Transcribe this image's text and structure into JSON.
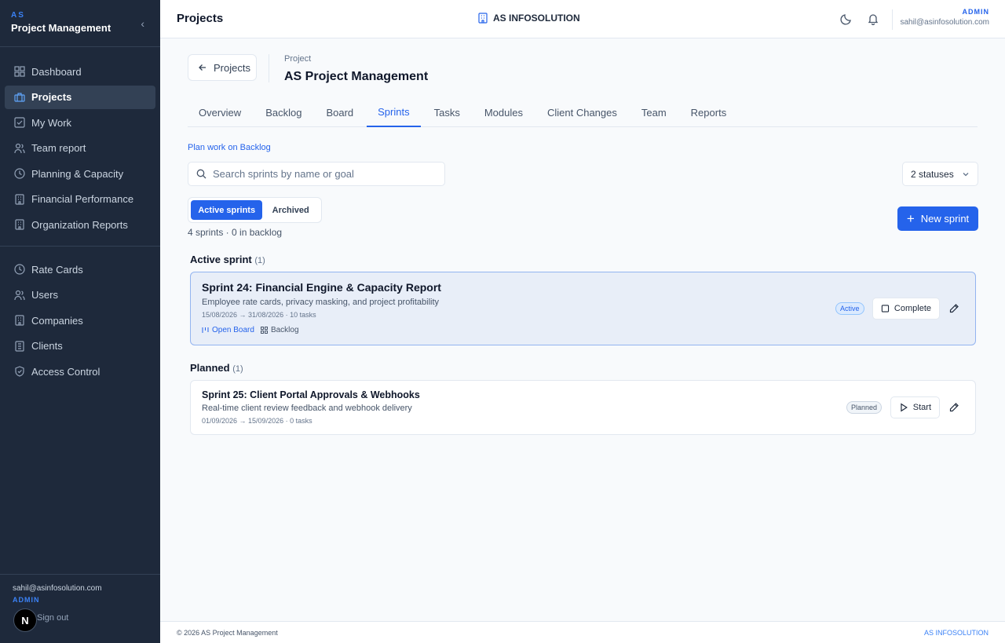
{
  "sidebar": {
    "brand_short": "AS",
    "brand_name": "Project Management",
    "nav_primary": [
      {
        "label": "Dashboard",
        "icon": "dashboard-icon"
      },
      {
        "label": "Projects",
        "icon": "briefcase-icon",
        "active": true
      },
      {
        "label": "My Work",
        "icon": "check-square-icon"
      },
      {
        "label": "Team report",
        "icon": "users-icon"
      },
      {
        "label": "Planning & Capacity",
        "icon": "clock-icon"
      },
      {
        "label": "Financial Performance",
        "icon": "building-icon"
      },
      {
        "label": "Organization Reports",
        "icon": "building-icon"
      }
    ],
    "nav_secondary": [
      {
        "label": "Rate Cards",
        "icon": "clock-icon"
      },
      {
        "label": "Users",
        "icon": "users-icon"
      },
      {
        "label": "Companies",
        "icon": "building-icon"
      },
      {
        "label": "Clients",
        "icon": "building-icon"
      },
      {
        "label": "Access Control",
        "icon": "shield-icon"
      }
    ],
    "footer": {
      "email": "sahil@asinfosolution.com",
      "role": "ADMIN",
      "signout": "Sign out",
      "badge": "N"
    }
  },
  "header": {
    "title": "Projects",
    "org": "AS INFOSOLUTION",
    "user_role": "ADMIN",
    "user_email": "sahil@asinfosolution.com"
  },
  "project": {
    "back_label": "Projects",
    "label": "Project",
    "name": "AS Project Management"
  },
  "tabs": [
    "Overview",
    "Backlog",
    "Board",
    "Sprints",
    "Tasks",
    "Modules",
    "Client Changes",
    "Team",
    "Reports"
  ],
  "active_tab": "Sprints",
  "sprints_page": {
    "plan_link": "Plan work on Backlog",
    "search_placeholder": "Search sprints by name or goal",
    "status_filter": "2 statuses",
    "seg_active": "Active sprints",
    "seg_archived": "Archived",
    "count_text": "4 sprints · 0 in backlog",
    "new_sprint": "New sprint"
  },
  "sections": {
    "active": {
      "title": "Active sprint",
      "count": "(1)"
    },
    "planned": {
      "title": "Planned",
      "count": "(1)"
    }
  },
  "sprint_active": {
    "title": "Sprint 24: Financial Engine & Capacity Report",
    "desc": "Employee rate cards, privacy masking, and project profitability",
    "meta": "15/08/2026 → 31/08/2026 · 10 tasks",
    "link_board": "Open Board",
    "link_backlog": "Backlog",
    "status": "Active",
    "action": "Complete"
  },
  "sprint_planned": {
    "title": "Sprint 25: Client Portal Approvals & Webhooks",
    "desc": "Real-time client review feedback and webhook delivery",
    "meta": "01/09/2026 → 15/09/2026 · 0 tasks",
    "status": "Planned",
    "action": "Start"
  },
  "footer": {
    "left": "© 2026 AS Project Management",
    "right": "AS INFOSOLUTION"
  },
  "colors": {
    "sidebar_bg": "#1e293b",
    "accent": "#2563eb",
    "page_bg": "#f8fafc",
    "active_card_bg": "#e8eef8"
  }
}
